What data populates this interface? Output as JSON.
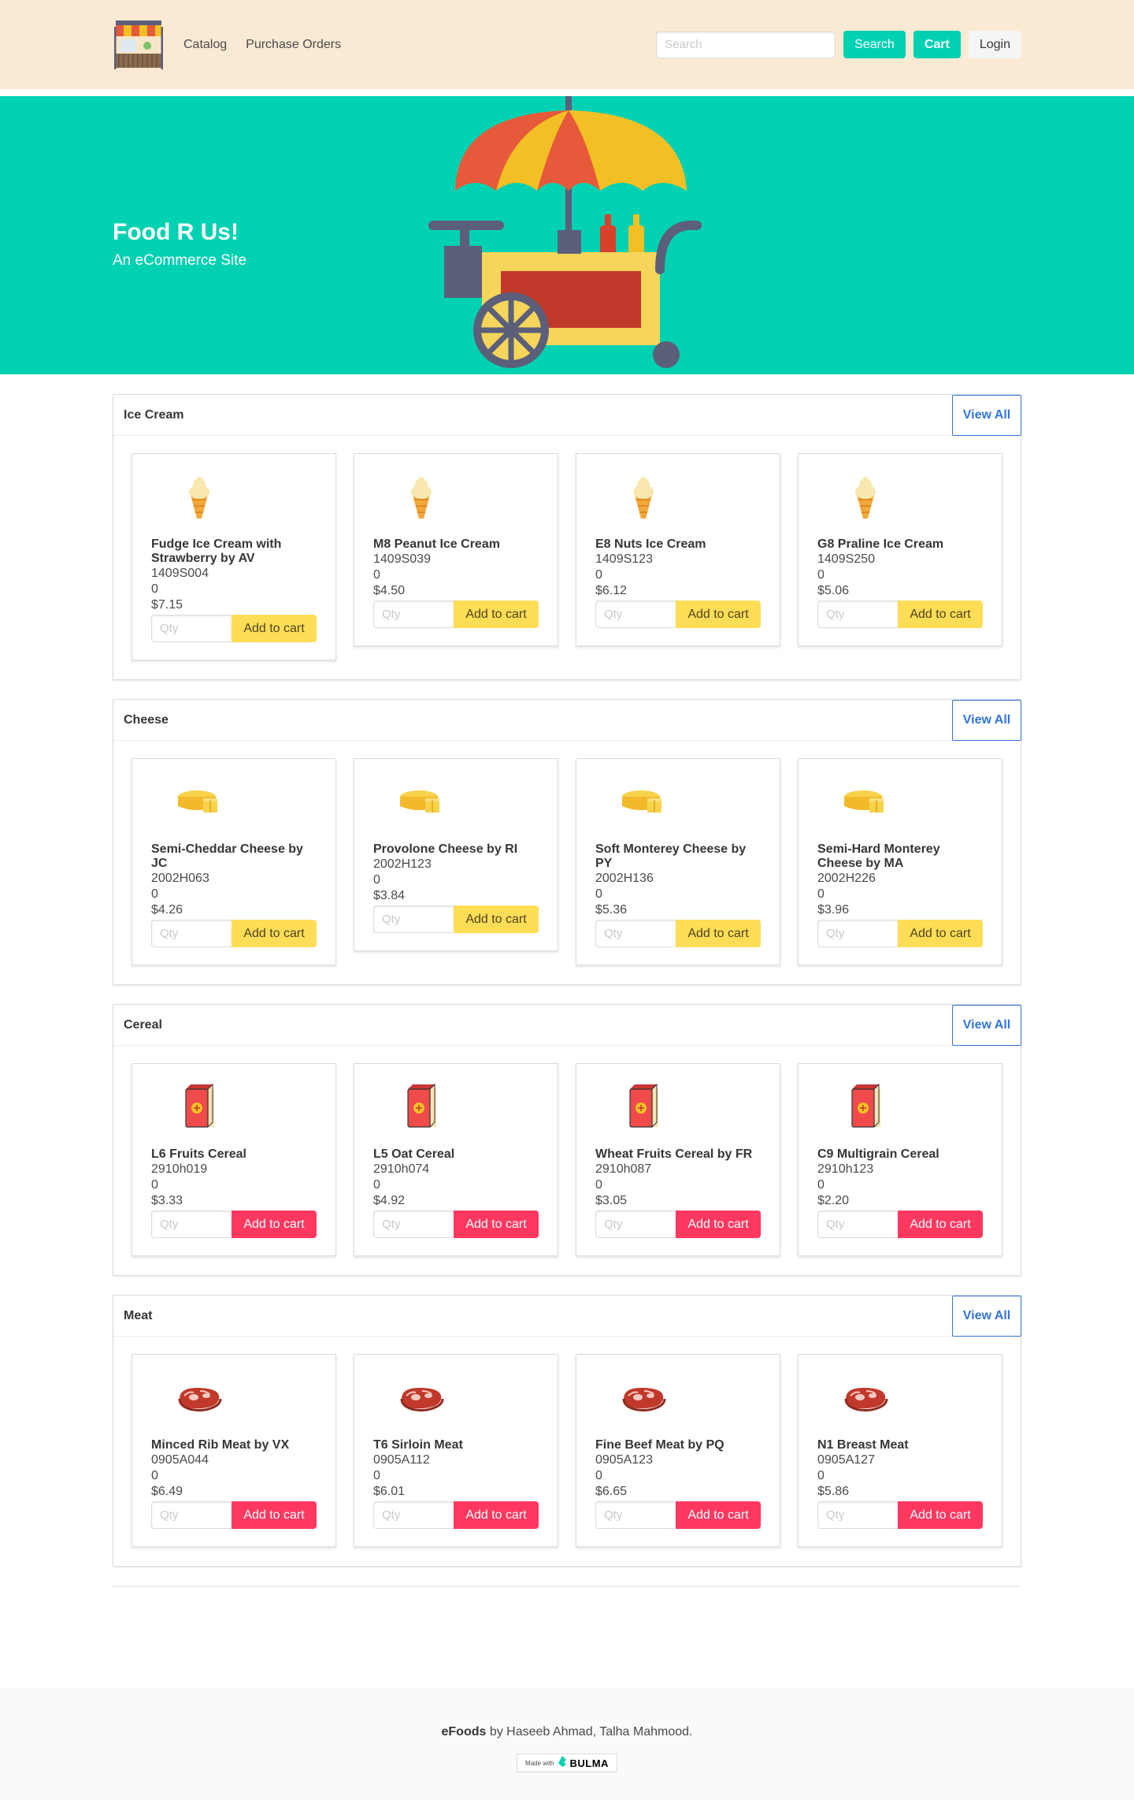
{
  "nav": {
    "links": [
      "Catalog",
      "Purchase Orders"
    ],
    "search_placeholder": "Search",
    "search_button": "Search",
    "cart_button": "Cart",
    "login_button": "Login"
  },
  "hero": {
    "title": "Food R Us!",
    "subtitle": "An eCommerce Site"
  },
  "sections": [
    {
      "title": "Ice Cream",
      "view_all": "View All",
      "icon": "ice-cream-icon",
      "button_color": "#ffdd57",
      "products": [
        {
          "name": "Fudge Ice Cream with Strawberry by AV",
          "code": "1409S004",
          "qty_line": "0",
          "price": "$7.15"
        },
        {
          "name": "M8 Peanut Ice Cream",
          "code": "1409S039",
          "qty_line": "0",
          "price": "$4.50"
        },
        {
          "name": "E8 Nuts Ice Cream",
          "code": "1409S123",
          "qty_line": "0",
          "price": "$6.12"
        },
        {
          "name": "G8 Praline Ice Cream",
          "code": "1409S250",
          "qty_line": "0",
          "price": "$5.06"
        }
      ]
    },
    {
      "title": "Cheese",
      "view_all": "View All",
      "icon": "cheese-icon",
      "button_color": "#ffdd57",
      "products": [
        {
          "name": "Semi-Cheddar Cheese by JC",
          "code": "2002H063",
          "qty_line": "0",
          "price": "$4.26"
        },
        {
          "name": "Provolone Cheese by RI",
          "code": "2002H123",
          "qty_line": "0",
          "price": "$3.84"
        },
        {
          "name": "Soft Monterey Cheese by PY",
          "code": "2002H136",
          "qty_line": "0",
          "price": "$5.36"
        },
        {
          "name": "Semi-Hard Monterey Cheese by MA",
          "code": "2002H226",
          "qty_line": "0",
          "price": "$3.96"
        }
      ]
    },
    {
      "title": "Cereal",
      "view_all": "View All",
      "icon": "cereal-box-icon",
      "button_color": "#ff3860",
      "products": [
        {
          "name": "L6 Fruits Cereal",
          "code": "2910h019",
          "qty_line": "0",
          "price": "$3.33"
        },
        {
          "name": "L5 Oat Cereal",
          "code": "2910h074",
          "qty_line": "0",
          "price": "$4.92"
        },
        {
          "name": "Wheat Fruits Cereal by FR",
          "code": "2910h087",
          "qty_line": "0",
          "price": "$3.05"
        },
        {
          "name": "C9 Multigrain Cereal",
          "code": "2910h123",
          "qty_line": "0",
          "price": "$2.20"
        }
      ]
    },
    {
      "title": "Meat",
      "view_all": "View All",
      "icon": "meat-steak-icon",
      "button_color": "#ff3860",
      "products": [
        {
          "name": "Minced Rib Meat by VX",
          "code": "0905A044",
          "qty_line": "0",
          "price": "$6.49"
        },
        {
          "name": "T6 Sirloin Meat",
          "code": "0905A112",
          "qty_line": "0",
          "price": "$6.01"
        },
        {
          "name": "Fine Beef Meat by PQ",
          "code": "0905A123",
          "qty_line": "0",
          "price": "$6.65"
        },
        {
          "name": "N1 Breast Meat",
          "code": "0905A127",
          "qty_line": "0",
          "price": "$5.86"
        }
      ]
    }
  ],
  "card_labels": {
    "qty_placeholder": "Qty",
    "add_to_cart": "Add to cart"
  },
  "footer": {
    "brand": "eFoods",
    "credit": " by Haseeb Ahmad, Talha Mahmood.",
    "badge_made_with": "Made with",
    "badge_brand": "BULMA"
  },
  "colors": {
    "navbar_bg": "#fbead3",
    "hero_bg": "#00d1b2",
    "link_blue": "#3273dc",
    "yellow": "#ffdd57",
    "red": "#ff3860"
  }
}
